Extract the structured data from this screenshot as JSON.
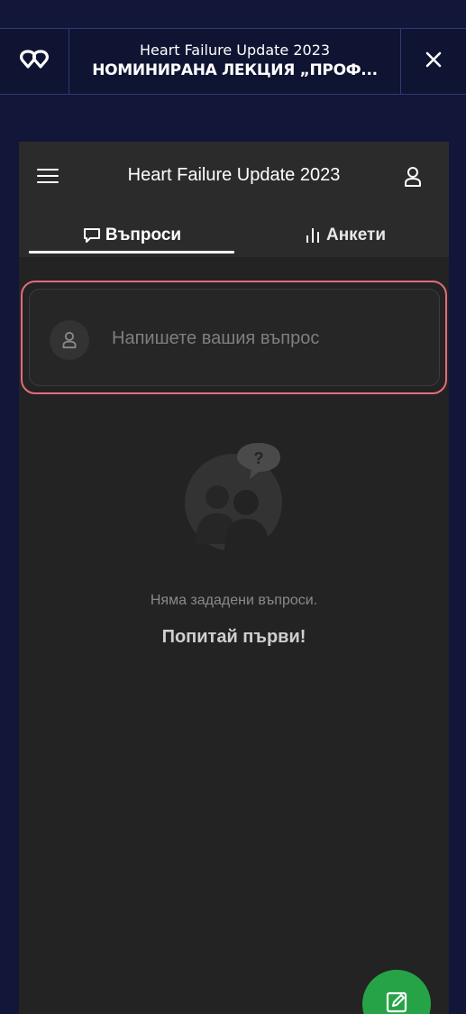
{
  "banner": {
    "event_title": "Heart Failure Update 2023",
    "session_title": "НОМИНИРАНА ЛЕКЦИЯ „ПРОФ...",
    "logo_icon": "heart-logo-icon",
    "close_icon": "close-icon"
  },
  "panel": {
    "title": "Heart Failure Update 2023",
    "menu_icon": "hamburger-menu-icon",
    "user_icon": "user-icon",
    "tabs": [
      {
        "label": "Въпроси",
        "icon": "chat-bubble-icon",
        "active": true
      },
      {
        "label": "Анкети",
        "icon": "bar-chart-icon",
        "active": false
      }
    ],
    "ask": {
      "placeholder": "Напишете вашия въпрос",
      "avatar_icon": "user-icon"
    },
    "empty": {
      "illustration_icon": "people-question-icon",
      "text": "Няма зададени въпроси.",
      "cta": "Попитай първи!"
    },
    "fab_icon": "edit-icon"
  },
  "colors": {
    "page_bg": "#121639",
    "banner_border": "#2f3a7a",
    "panel_bg": "#232323",
    "header_bg": "#2b2b2b",
    "highlight": "#e46c7d",
    "fab": "#27a347"
  }
}
